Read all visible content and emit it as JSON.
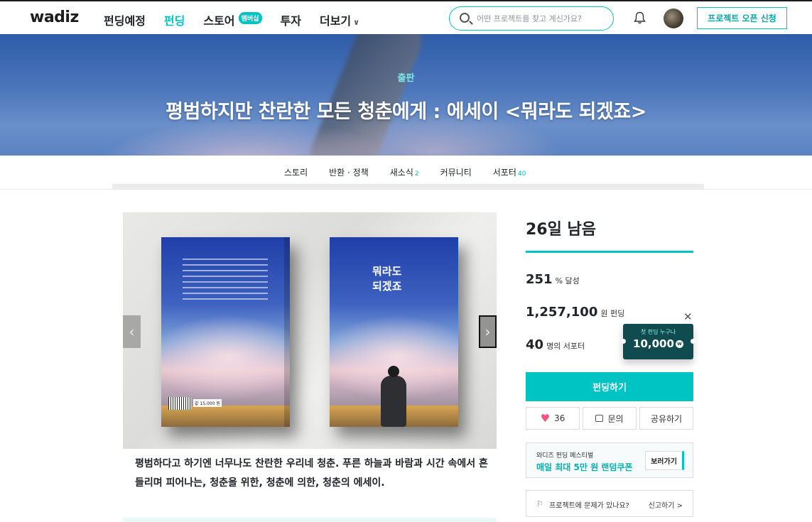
{
  "header": {
    "logo": "wadiz",
    "nav": [
      {
        "label": "펀딩예정"
      },
      {
        "label": "펀딩"
      },
      {
        "label": "스토어",
        "badge": "멤버십"
      },
      {
        "label": "투자"
      },
      {
        "label": "더보기"
      }
    ],
    "search_placeholder": "어떤 프로젝트를 찾고 계신가요?",
    "open_button": "프로젝트 오픈 신청"
  },
  "hero": {
    "category": "출판",
    "title": "평범하지만 찬란한 모든 청춘에게 : 에세이 <뭐라도 되겠죠>"
  },
  "tabs": [
    {
      "label": "스토리",
      "count": ""
    },
    {
      "label": "반환 · 정책",
      "count": ""
    },
    {
      "label": "새소식",
      "count": "2"
    },
    {
      "label": "커뮤니티",
      "count": ""
    },
    {
      "label": "서포터",
      "count": "40"
    }
  ],
  "book": {
    "cover_title": "뭐라도\n되겠죠",
    "price_label": "값 15,000 원"
  },
  "intro": "평범하다고 하기엔 너무나도 찬란한 우리네 청춘. 푸른 하늘과 바람과 시간 속에서 흔들리며 피어나는, 청춘을 위한, 청춘에 의한, 청춘의 에세이.",
  "side": {
    "days_left": "26일 남음",
    "achieved": {
      "value": "251",
      "unit": "% 달성"
    },
    "amount": {
      "value": "1,257,100",
      "unit": "원 펀딩"
    },
    "supporters": {
      "value": "40",
      "unit": "명의 서포터"
    },
    "coupon": {
      "top": "첫 펀딩 누구나",
      "amount": "10,000",
      "won": "w"
    },
    "fund_button": "펀딩하기",
    "like_count": "36",
    "inquiry": "문의",
    "share": "공유하기",
    "festival": {
      "line1": "와디즈 펀딩 페스티벌",
      "line2": "매일 최대 5만 원 랜덤쿠폰",
      "view": "보러가기"
    },
    "report": {
      "text": "프로젝트에 문제가 있나요?",
      "link": "신고하기 >"
    }
  }
}
